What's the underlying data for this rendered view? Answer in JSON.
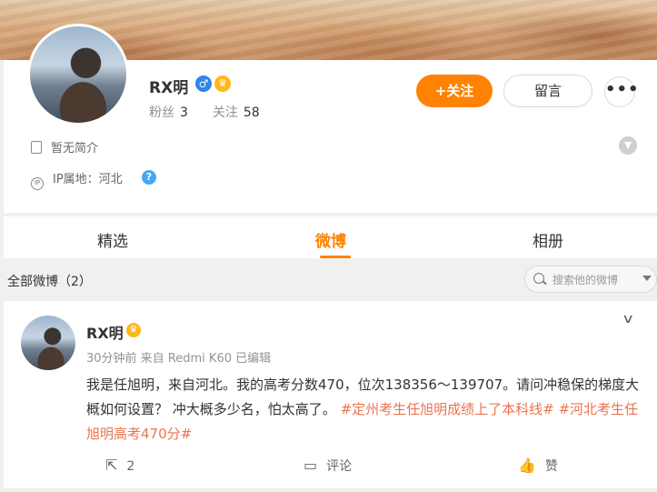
{
  "profile": {
    "username": "RX明",
    "gender_icon": "male-icon",
    "stats": {
      "fans_label": "粉丝",
      "fans": "3",
      "following_label": "关注",
      "following": "58"
    },
    "follow_label": "+关注",
    "message_label": "留言",
    "more_label": "•••",
    "bio": "暂无简介",
    "ip_location": "IP属地：河北"
  },
  "tabs": [
    {
      "label": "精选"
    },
    {
      "label": "微博"
    },
    {
      "label": "相册"
    }
  ],
  "active_tab": "微博",
  "filter": {
    "label": "全部微博（2）",
    "search_placeholder": "搜索他的微博"
  },
  "post": {
    "author": "RX明",
    "meta": "30分钟前 来自 Redmi K60 已编辑",
    "text": "我是任旭明，来自河北。我的高考分数470，位次138356～139707。请问冲稳保的梯度大概如何设置？ 冲大概多少名，怕太高了。",
    "topics": [
      "#定州考生任旭明成绩上了本科线#",
      "#河北考生任旭明高考470分#"
    ],
    "repost_count": "2",
    "comment_label": "评论",
    "like_label": "赞"
  },
  "colors": {
    "accent": "#ff8200",
    "topic": "#eb7350",
    "page_bg": "#f0f0f0"
  }
}
